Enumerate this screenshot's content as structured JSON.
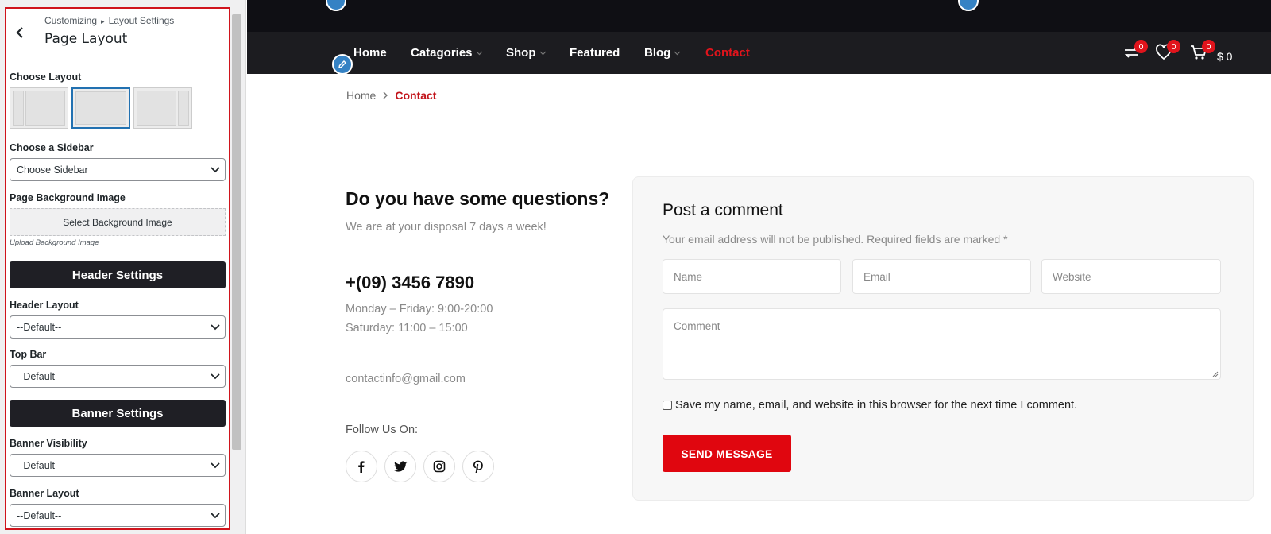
{
  "customizer": {
    "breadcrumb": [
      "Customizing",
      "Layout Settings"
    ],
    "title": "Page Layout",
    "choose_layout_label": "Choose Layout",
    "layout_options": [
      "left-sidebar",
      "full-width",
      "right-sidebar"
    ],
    "selected_layout": "full-width",
    "sidebar_label": "Choose a Sidebar",
    "sidebar_value": "Choose Sidebar",
    "bg_label": "Page Background Image",
    "bg_button": "Select Background Image",
    "bg_description": "Upload Background Image",
    "header_settings": "Header Settings",
    "header_layout_label": "Header Layout",
    "header_layout_value": "--Default--",
    "top_bar_label": "Top Bar",
    "top_bar_value": "--Default--",
    "banner_settings": "Banner Settings",
    "banner_visibility_label": "Banner Visibility",
    "banner_visibility_value": "--Default--",
    "banner_layout_label": "Banner Layout",
    "banner_layout_value": "--Default--"
  },
  "nav": {
    "items": [
      {
        "label": "Home",
        "dropdown": false,
        "active": false
      },
      {
        "label": "Catagories",
        "dropdown": true,
        "active": false
      },
      {
        "label": "Shop",
        "dropdown": true,
        "active": false
      },
      {
        "label": "Featured",
        "dropdown": false,
        "active": false
      },
      {
        "label": "Blog",
        "dropdown": true,
        "active": false
      },
      {
        "label": "Contact",
        "dropdown": false,
        "active": true
      }
    ],
    "compare_count": "0",
    "wishlist_count": "0",
    "cart_count": "0",
    "cart_total": "$ 0"
  },
  "breadcrumb": {
    "home": "Home",
    "current": "Contact"
  },
  "contact": {
    "title": "Do you have some questions?",
    "subtitle": "We are at your disposal 7 days a week!",
    "phone": "+(09) 3456 7890",
    "hours_weekday": "Monday – Friday: 9:00-20:00",
    "hours_saturday": "Saturday: 11:00 – 15:00",
    "email": "contactinfo@gmail.com",
    "follow": "Follow Us On:",
    "socials": [
      "facebook-icon",
      "twitter-icon",
      "instagram-icon",
      "pinterest-icon"
    ]
  },
  "comment": {
    "title": "Post a comment",
    "note": "Your email address will not be published. Required fields are marked",
    "required_mark": "*",
    "name_placeholder": "Name",
    "email_placeholder": "Email",
    "website_placeholder": "Website",
    "comment_placeholder": "Comment",
    "save_label": "Save my name, email, and website in this browser for the next time I comment.",
    "send_button": "SEND MESSAGE"
  },
  "colors": {
    "accent": "#e0141c",
    "dark": "#1c1c20",
    "link_blue": "#2271b1"
  }
}
